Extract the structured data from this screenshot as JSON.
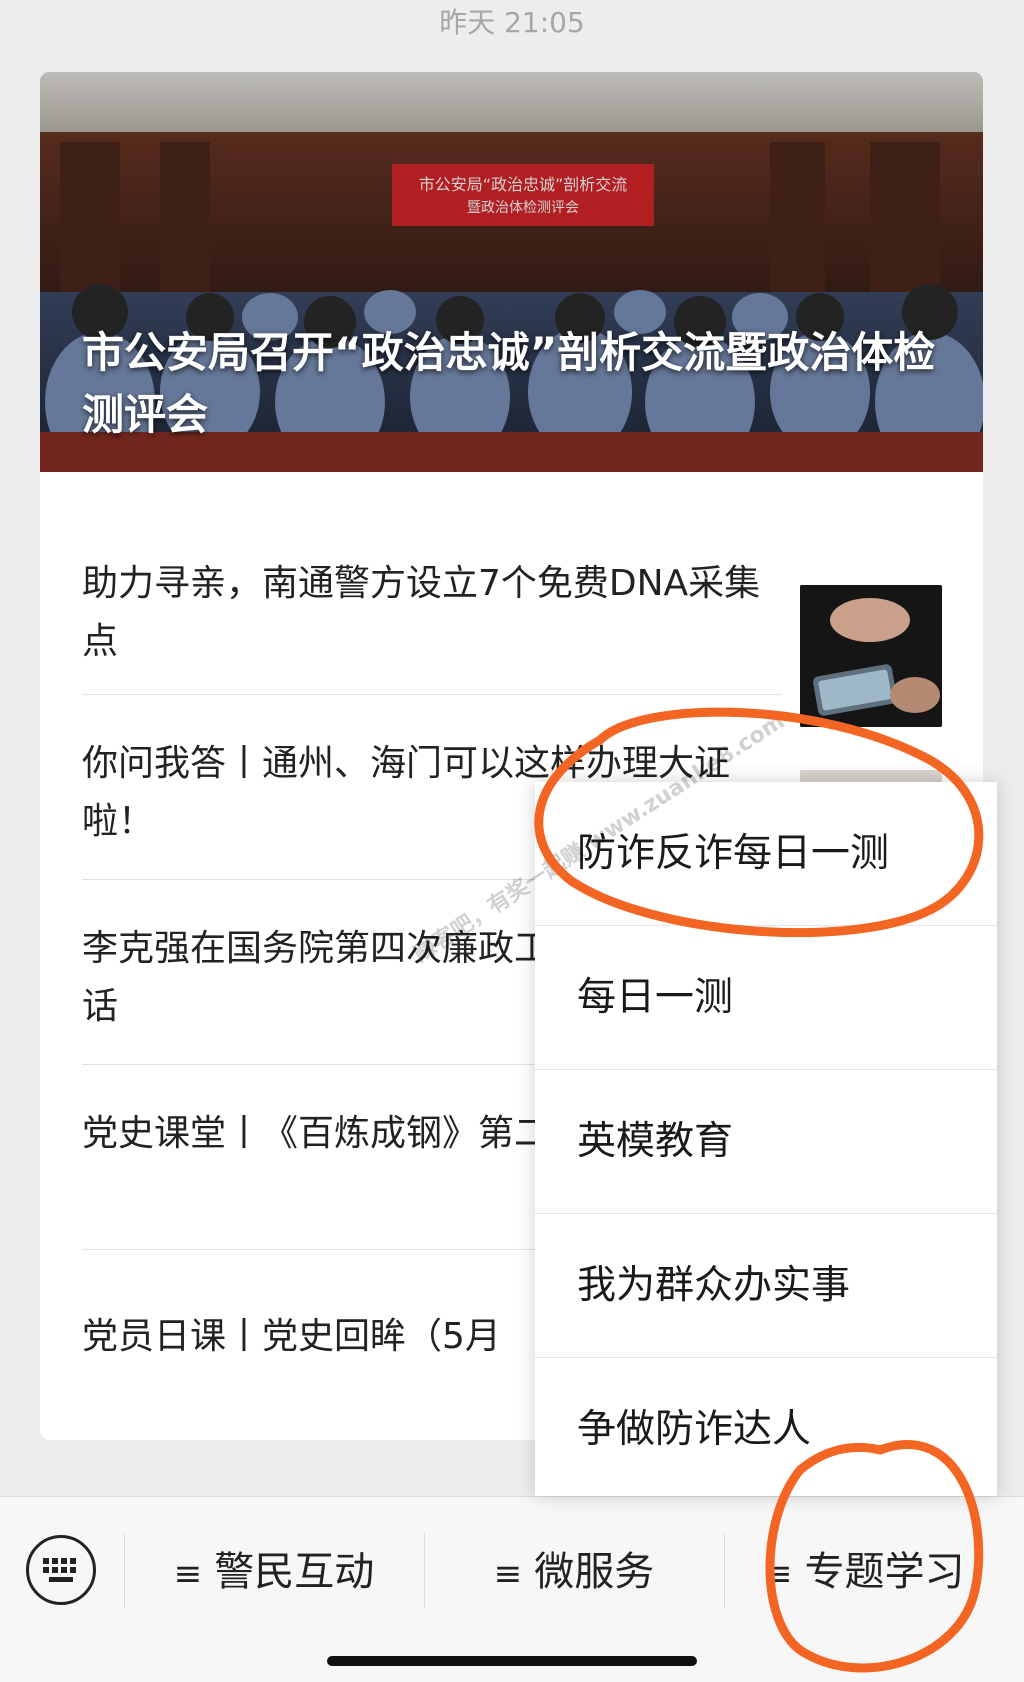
{
  "header": {
    "timestamp": "昨天 21:05"
  },
  "hero": {
    "banner_text": "市公安局“政治忠诚”剖析交流暨政治体检测评会",
    "title": "市公安局召开“政治忠诚”剖析交流暨政治体检测评会"
  },
  "articles": [
    {
      "title": "助力寻亲，南通警方设立7个免费DNA采集点"
    },
    {
      "title": "你问我答丨通州、海门可以这样办理大证啦！"
    },
    {
      "title": "李克强在国务院第四次廉政工作会议上的讲话"
    },
    {
      "title": "党史课堂丨《百炼成钢》第二集 愚公移山"
    },
    {
      "title": "党员日课丨党史回眸（5月"
    }
  ],
  "popup_menu": {
    "items": [
      {
        "label": "防诈反诈每日一测"
      },
      {
        "label": "每日一测"
      },
      {
        "label": "英模教育"
      },
      {
        "label": "我为群众办实事"
      },
      {
        "label": "争做防诈达人"
      }
    ]
  },
  "bottom_menu": {
    "keyboard_icon": "keyboard-icon",
    "items": [
      {
        "icon": "≡",
        "label": "警民互动"
      },
      {
        "icon": "≡",
        "label": "微服务"
      },
      {
        "icon": "≡",
        "label": "专题学习"
      }
    ]
  },
  "watermark": {
    "text": "赚客吧，有奖一起赚 www.zuanke8.com"
  },
  "colors": {
    "annotation": "#f26522",
    "banner_red": "#d9262b"
  }
}
